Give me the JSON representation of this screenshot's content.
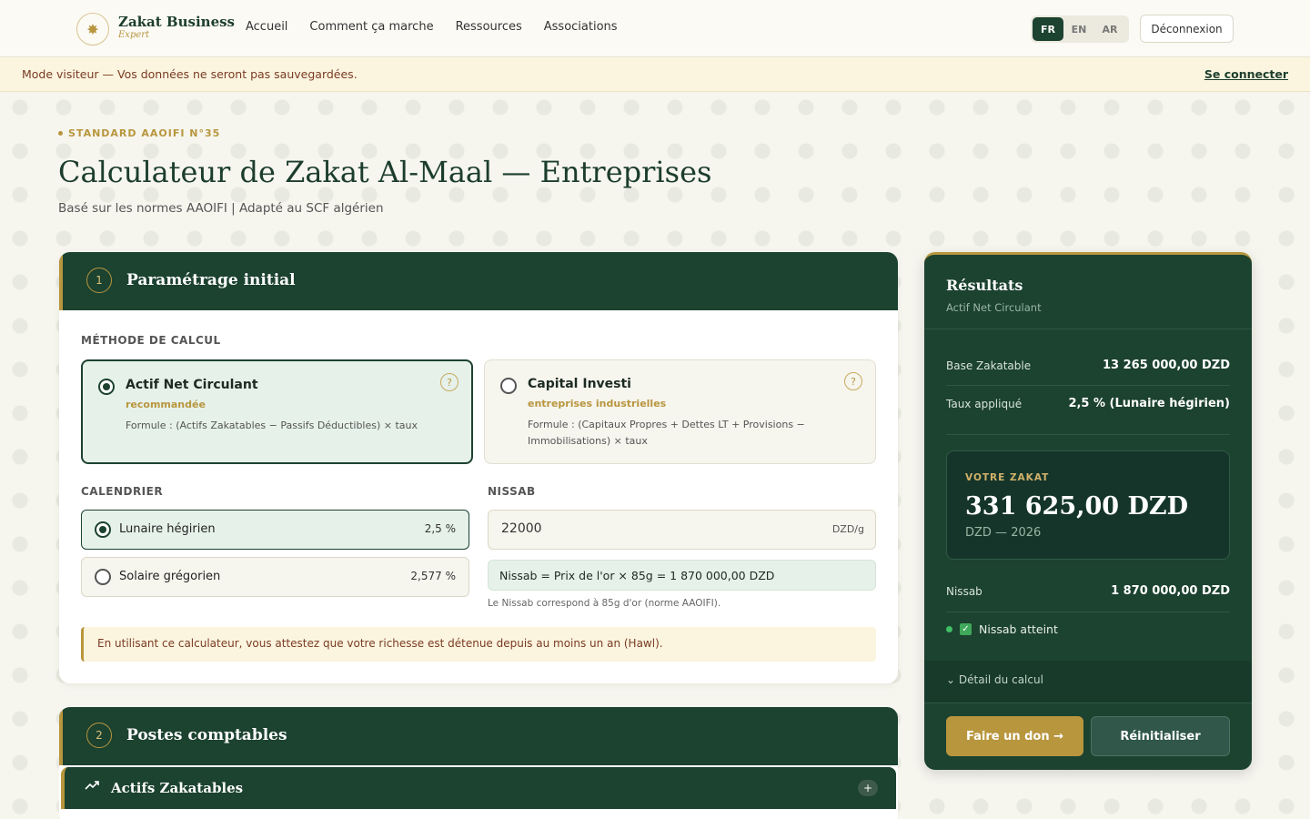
{
  "header": {
    "logo_icon": "star-icon",
    "logo_title": "Zakat Business",
    "logo_subtitle": "Expert",
    "nav": [
      "Accueil",
      "Comment ça marche",
      "Ressources",
      "Associations"
    ],
    "languages": [
      "FR",
      "EN",
      "AR"
    ],
    "active_language": "FR",
    "logout_label": "Déconnexion"
  },
  "banner": {
    "text": "Mode visiteur — Vos données ne seront pas sauvegardées.",
    "link": "Se connecter"
  },
  "page": {
    "eyebrow": "STANDARD AAOIFI N°35",
    "title": "Calculateur de Zakat Al-Maal — Entreprises",
    "subtitle": "Basé sur les normes AAOIFI | Adapté au SCF algérien"
  },
  "section1": {
    "number": "1",
    "title": "Paramétrage initial",
    "method_label": "MÉTHODE DE CALCUL",
    "methods": [
      {
        "title": "Actif Net Circulant",
        "tag": "recommandée",
        "formula": "Formule : (Actifs Zakatables − Passifs Déductibles) × taux",
        "help": "?"
      },
      {
        "title": "Capital Investi",
        "tag": "entreprises industrielles",
        "formula": "Formule : (Capitaux Propres + Dettes LT + Provisions − Immobilisations) × taux",
        "help": "?"
      }
    ],
    "calendar_label": "CALENDRIER",
    "calendars": [
      {
        "label": "Lunaire hégirien",
        "rate": "2,5 %"
      },
      {
        "label": "Solaire grégorien",
        "rate": "2,577 %"
      }
    ],
    "nissab_label": "NISSAB",
    "nissab_value": "22000",
    "nissab_unit": "DZD/g",
    "nissab_calc": "Nissab = Prix de l'or × 85g =  1 870 000,00 DZD",
    "nissab_note": "Le Nissab correspond à 85g d'or (norme AAOIFI).",
    "attest": "En utilisant ce calculateur, vous attestez que votre richesse est détenue depuis au moins un an (Hawl)."
  },
  "section2": {
    "number": "2",
    "title": "Postes comptables",
    "sub_icon": "trending-up-icon",
    "sub_title": "Actifs Zakatables",
    "sub_toggle": "+"
  },
  "results": {
    "title": "Résultats",
    "subtitle": "Actif Net Circulant",
    "base_label": "Base Zakatable",
    "base_value": "13 265 000,00 DZD",
    "rate_label": "Taux appliqué",
    "rate_value": "2,5 % (Lunaire hégirien)",
    "zakat_label": "VOTRE ZAKAT",
    "zakat_amount": "331 625,00 DZD",
    "zakat_sub": "DZD — 2026",
    "nissab_label": "Nissab",
    "nissab_value": "1 870 000,00 DZD",
    "nissab_status": "Nissab atteint",
    "detail_label": "Détail du calcul",
    "donate_label": "Faire un don →",
    "reset_label": "Réinitialiser"
  }
}
